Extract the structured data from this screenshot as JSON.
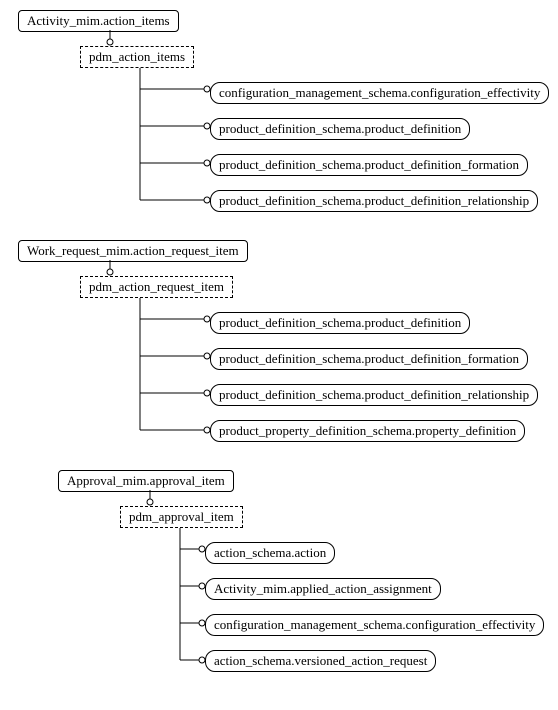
{
  "groups": [
    {
      "root": "Activity_mim.action_items",
      "sub": "pdm_action_items",
      "items": [
        "configuration_management_schema.configuration_effectivity",
        "product_definition_schema.product_definition",
        "product_definition_schema.product_definition_formation",
        "product_definition_schema.product_definition_relationship"
      ]
    },
    {
      "root": "Work_request_mim.action_request_item",
      "sub": "pdm_action_request_item",
      "items": [
        "product_definition_schema.product_definition",
        "product_definition_schema.product_definition_formation",
        "product_definition_schema.product_definition_relationship",
        "product_property_definition_schema.property_definition"
      ]
    },
    {
      "root": "Approval_mim.approval_item",
      "sub": "pdm_approval_item",
      "items": [
        "action_schema.action",
        "Activity_mim.applied_action_assignment",
        "configuration_management_schema.configuration_effectivity",
        "action_schema.versioned_action_request"
      ]
    }
  ]
}
